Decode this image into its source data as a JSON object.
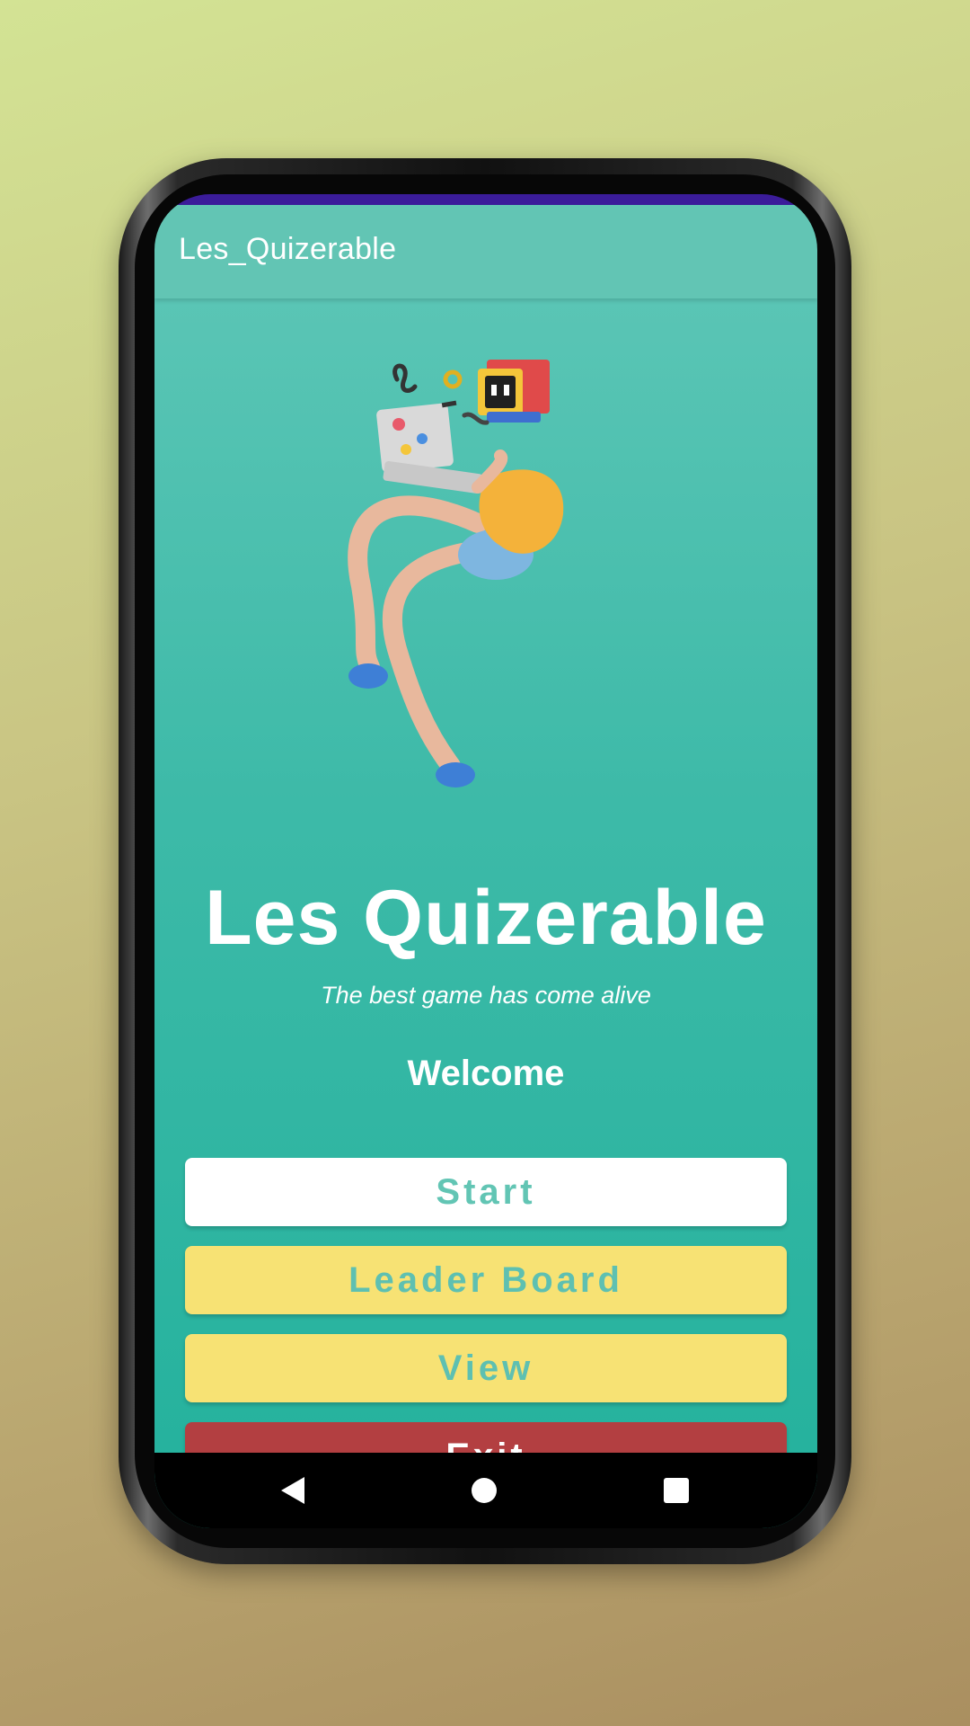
{
  "app_bar": {
    "title": "Les_Quizerable"
  },
  "hero": {
    "title": "Les Quizerable",
    "subtitle": "The best game has come alive",
    "welcome": "Welcome"
  },
  "buttons": {
    "start": "Start",
    "leader_board": "Leader Board",
    "view": "View",
    "exit": "Exit"
  },
  "nav": {
    "back_icon": "back-triangle-icon",
    "home_icon": "home-circle-icon",
    "recent_icon": "recent-square-icon"
  },
  "colors": {
    "app_bar": "#62c5b4",
    "background_top": "#5ac5b5",
    "background_bottom": "#22b19c",
    "start_button": "#ffffff",
    "secondary_button": "#f7e274",
    "exit_button": "#b33f41",
    "status_strip": "#3b1c9a"
  }
}
